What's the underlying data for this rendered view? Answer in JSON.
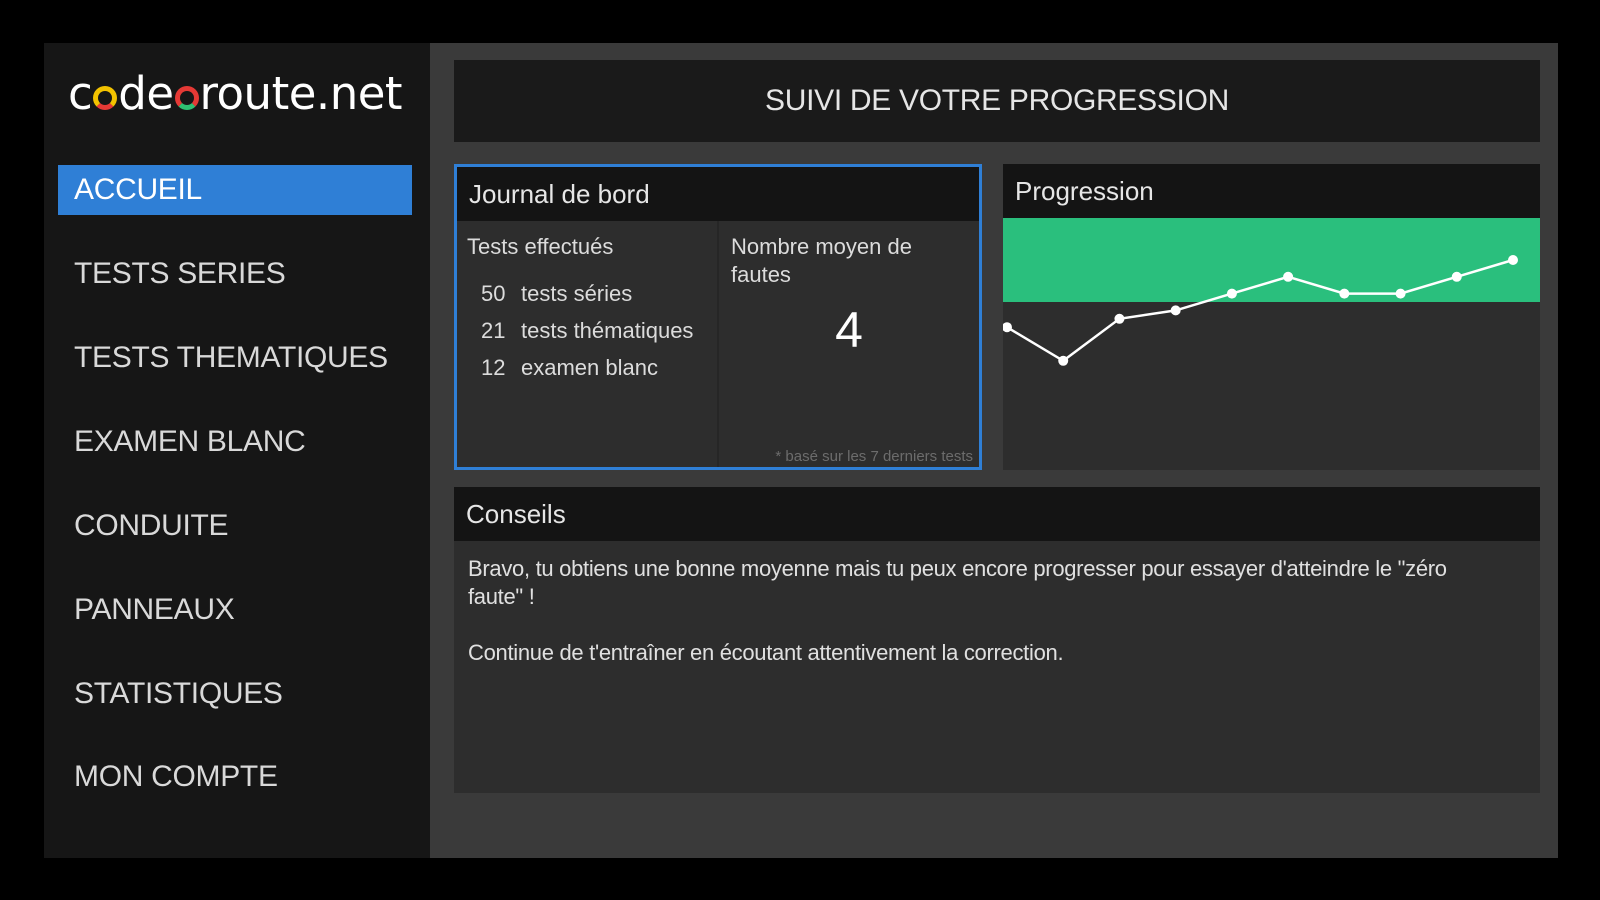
{
  "app": {
    "logo_text": {
      "prefix": "c",
      "middle": "de",
      "suffix": "route.net"
    }
  },
  "sidebar": {
    "items": [
      {
        "label": "ACCUEIL",
        "active": true
      },
      {
        "label": "TESTS SERIES",
        "active": false
      },
      {
        "label": "TESTS THEMATIQUES",
        "active": false
      },
      {
        "label": "EXAMEN BLANC",
        "active": false
      },
      {
        "label": "CONDUITE",
        "active": false
      },
      {
        "label": "PANNEAUX",
        "active": false
      },
      {
        "label": "STATISTIQUES",
        "active": false
      },
      {
        "label": "MON COMPTE",
        "active": false
      }
    ]
  },
  "header": {
    "title": "SUIVI DE VOTRE PROGRESSION"
  },
  "journal": {
    "title": "Journal de bord",
    "tests_title": "Tests effectués",
    "tests": [
      {
        "count": "50",
        "label": "tests séries"
      },
      {
        "count": "21",
        "label": "tests thématiques"
      },
      {
        "count": "12",
        "label": "examen blanc"
      }
    ],
    "avg_title": "Nombre moyen de fautes",
    "avg_value": "4",
    "avg_note": "* basé sur les 7 derniers tests"
  },
  "progression": {
    "title": "Progression",
    "colors": {
      "good_zone": "#2abf7d",
      "line": "#ffffff"
    }
  },
  "chart_data": {
    "type": "line",
    "series": [
      {
        "values": [
          6.5,
          8.5,
          6.0,
          5.5,
          4.5,
          3.5,
          4.5,
          4.5,
          3.5,
          2.5
        ]
      }
    ],
    "good_zone": [
      0,
      5
    ],
    "ylim": [
      0,
      15
    ]
  },
  "conseils": {
    "title": "Conseils",
    "paragraphs": [
      "Bravo, tu obtiens une bonne moyenne mais tu peux encore progresser pour essayer d'atteindre le \"zéro faute\" !",
      "Continue de t'entraîner en écoutant attentivement la correction."
    ]
  },
  "colors": {
    "accent": "#2f7fd6",
    "sidebar_bg": "#161616",
    "content_bg": "#3a3a3a"
  }
}
